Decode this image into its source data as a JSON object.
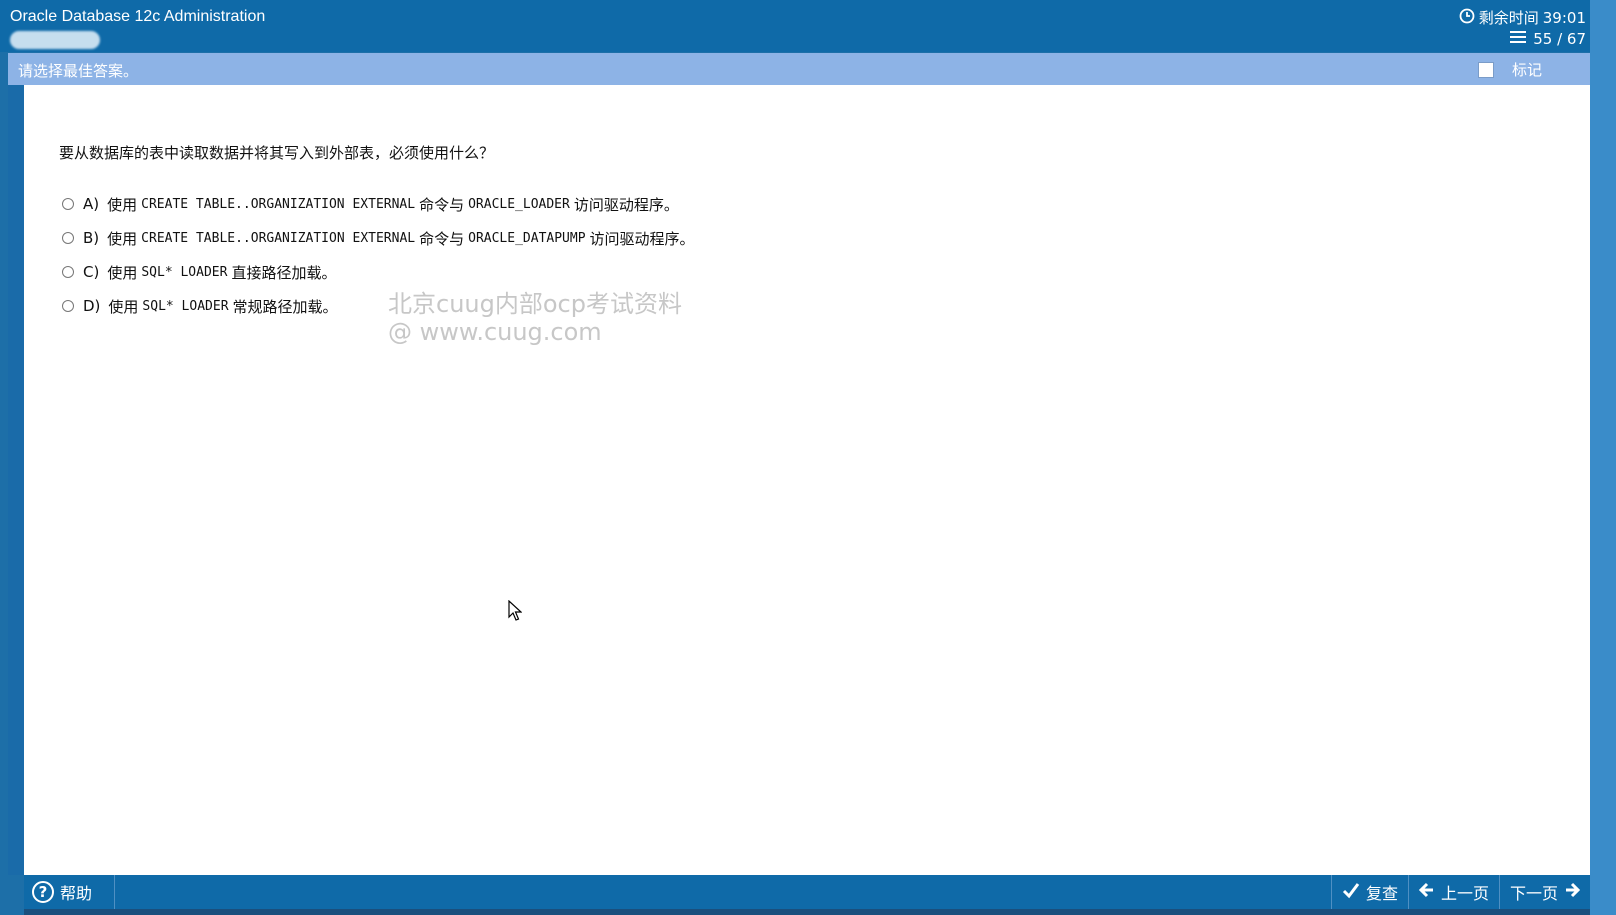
{
  "header": {
    "app_title": "Oracle Database 12c Administration",
    "timer_label": "剩余时间",
    "timer_value": "39:01",
    "progress": "55 / 67"
  },
  "instruction": {
    "text": "请选择最佳答案。",
    "mark_label": "标记"
  },
  "question": {
    "text": "要从数据库的表中读取数据并将其写入到外部表，必须使用什么？",
    "options": [
      {
        "letter": "A)",
        "pre": "使用",
        "code": "CREATE TABLE..ORGANIZATION EXTERNAL",
        "mid": "命令与",
        "code2": "ORACLE_LOADER",
        "post": "访问驱动程序。"
      },
      {
        "letter": "B)",
        "pre": "使用",
        "code": "CREATE TABLE..ORGANIZATION EXTERNAL",
        "mid": "命令与",
        "code2": "ORACLE_DATAPUMP",
        "post": "访问驱动程序。"
      },
      {
        "letter": "C)",
        "pre": "使用",
        "code": "SQL* LOADER",
        "post": "直接路径加载。"
      },
      {
        "letter": "D)",
        "pre": "使用",
        "code": "SQL* LOADER",
        "post": "常规路径加载。"
      }
    ]
  },
  "watermark": {
    "line1": "北京cuug内部ocp考试资料",
    "line2": "@ www.cuug.com"
  },
  "footer": {
    "help_label": "帮助",
    "review_label": "复查",
    "prev_label": "上一页",
    "next_label": "下一页"
  },
  "colors": {
    "header_bg": "#0f6aa8",
    "instruction_bg": "#8db3e6",
    "content_bg": "#ffffff"
  }
}
